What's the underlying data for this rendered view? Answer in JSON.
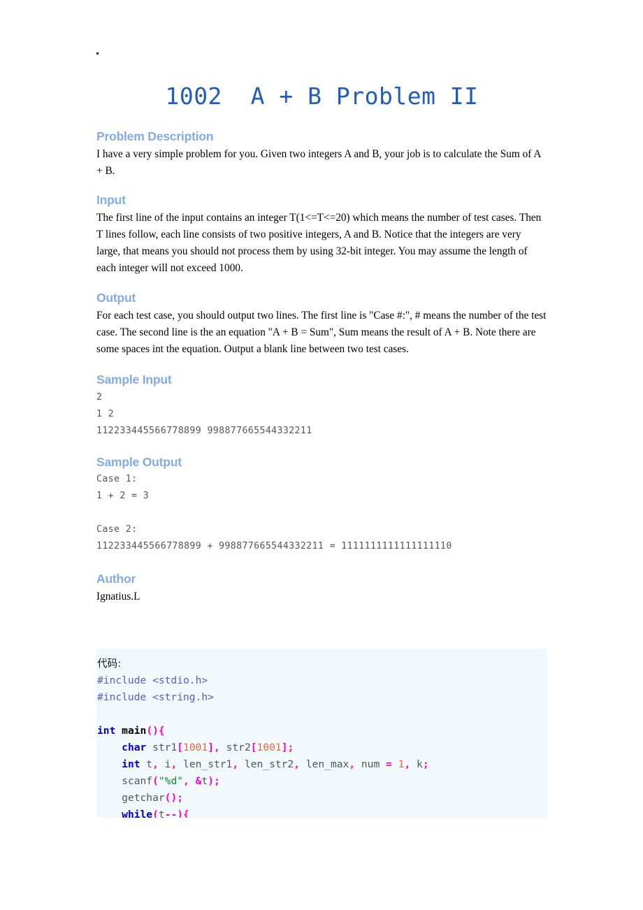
{
  "page": {
    "title": "1002  A + B Problem II",
    "background_color": "#ffffff",
    "title_color": "#1f5cbf",
    "heading_color": "#85aae8",
    "code_background_color": "#f1f9fd"
  },
  "sections": [
    {
      "id": "description",
      "heading": "Problem Description",
      "kind": "prose",
      "body": "I have a very simple problem for you. Given two integers A and B, your job is to calculate the Sum of A + B."
    },
    {
      "id": "input",
      "heading": "Input",
      "kind": "prose",
      "body": "The first line of the input contains an integer T(1<=T<=20) which means the number of test cases. Then T lines follow, each line consists of two positive integers, A and B. Notice that the integers are very large, that means you should not process them by using 32-bit integer. You may assume the length of each integer will not exceed 1000."
    },
    {
      "id": "output",
      "heading": "Output",
      "kind": "prose",
      "body": "For each test case, you should output two lines. The first line is \"Case #:\", # means the number of the test case. The second line is the an equation \"A + B = Sum\", Sum means the result of A + B. Note there are some spaces int the equation. Output a blank line between two test cases."
    },
    {
      "id": "sample-input",
      "heading": "Sample Input",
      "kind": "mono",
      "body": "2\n1 2\n112233445566778899 998877665544332211"
    },
    {
      "id": "sample-output",
      "heading": "Sample Output",
      "kind": "mono",
      "body": "Case 1:\n1 + 2 = 3\n\nCase 2:\n112233445566778899 + 998877665544332211 = 1111111111111111110"
    },
    {
      "id": "author",
      "heading": "Author",
      "kind": "prose",
      "body": "Ignatius.L"
    }
  ],
  "code": {
    "caption": "代码:",
    "language": "c",
    "lines": [
      [
        {
          "t": "#include ",
          "c": "pre"
        },
        {
          "t": "<stdio.h>",
          "c": "pre"
        }
      ],
      [
        {
          "t": "#include ",
          "c": "pre"
        },
        {
          "t": "<string.h>",
          "c": "pre"
        }
      ],
      [],
      [
        {
          "t": "int",
          "c": "kw"
        },
        {
          "t": " ",
          "c": "plain"
        },
        {
          "t": "main",
          "c": "fn"
        },
        {
          "t": "(){",
          "c": "pun"
        }
      ],
      [
        {
          "t": "    ",
          "c": "plain"
        },
        {
          "t": "char",
          "c": "kw"
        },
        {
          "t": " str1",
          "c": "id"
        },
        {
          "t": "[",
          "c": "pun"
        },
        {
          "t": "1001",
          "c": "num"
        },
        {
          "t": "]",
          "c": "pun"
        },
        {
          "t": ",",
          "c": "pun"
        },
        {
          "t": " str2",
          "c": "id"
        },
        {
          "t": "[",
          "c": "pun"
        },
        {
          "t": "1001",
          "c": "num"
        },
        {
          "t": "];",
          "c": "pun"
        }
      ],
      [
        {
          "t": "    ",
          "c": "plain"
        },
        {
          "t": "int",
          "c": "kw"
        },
        {
          "t": " t",
          "c": "id"
        },
        {
          "t": ",",
          "c": "pun"
        },
        {
          "t": " i",
          "c": "id"
        },
        {
          "t": ",",
          "c": "pun"
        },
        {
          "t": " len_str1",
          "c": "id"
        },
        {
          "t": ",",
          "c": "pun"
        },
        {
          "t": " len_str2",
          "c": "id"
        },
        {
          "t": ",",
          "c": "pun"
        },
        {
          "t": " len_max",
          "c": "id"
        },
        {
          "t": ",",
          "c": "pun"
        },
        {
          "t": " num ",
          "c": "id"
        },
        {
          "t": "=",
          "c": "pun"
        },
        {
          "t": " ",
          "c": "plain"
        },
        {
          "t": "1",
          "c": "num"
        },
        {
          "t": ",",
          "c": "pun"
        },
        {
          "t": " k",
          "c": "id"
        },
        {
          "t": ";",
          "c": "pun"
        }
      ],
      [
        {
          "t": "    ",
          "c": "plain"
        },
        {
          "t": "scanf",
          "c": "id"
        },
        {
          "t": "(",
          "c": "pun"
        },
        {
          "t": "\"%d\"",
          "c": "str"
        },
        {
          "t": ",",
          "c": "pun"
        },
        {
          "t": " ",
          "c": "plain"
        },
        {
          "t": "&",
          "c": "pun"
        },
        {
          "t": "t",
          "c": "id"
        },
        {
          "t": ");",
          "c": "pun"
        }
      ],
      [
        {
          "t": "    ",
          "c": "plain"
        },
        {
          "t": "getchar",
          "c": "id"
        },
        {
          "t": "();",
          "c": "pun"
        }
      ],
      [
        {
          "t": "    ",
          "c": "plain"
        },
        {
          "t": "while",
          "c": "kw"
        },
        {
          "t": "(",
          "c": "pun"
        },
        {
          "t": "t",
          "c": "id"
        },
        {
          "t": "--",
          "c": "pun"
        },
        {
          "t": "){",
          "c": "pun"
        }
      ]
    ]
  }
}
